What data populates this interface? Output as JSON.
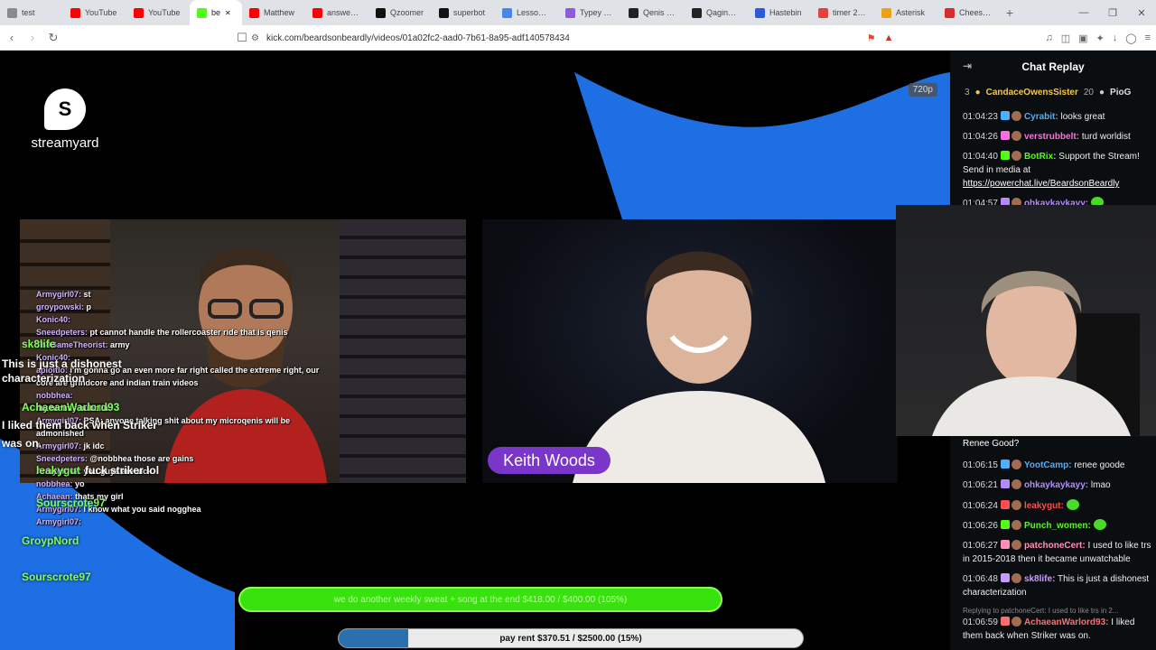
{
  "browser": {
    "tabs": [
      {
        "title": "test",
        "icon": "globe-icon",
        "color": "#8a8a8a"
      },
      {
        "title": "YouTube",
        "icon": "youtube-icon",
        "color": "#ff0000"
      },
      {
        "title": "YouTube",
        "icon": "youtube-icon",
        "color": "#ff0000"
      },
      {
        "title": "be",
        "icon": "kick-icon",
        "color": "#53fc18",
        "active": true
      },
      {
        "title": "Matthew",
        "icon": "youtube-icon",
        "color": "#ff0000"
      },
      {
        "title": "answering",
        "icon": "youtube-icon",
        "color": "#ff0000"
      },
      {
        "title": "Qzoomer",
        "icon": "x-icon",
        "color": "#111111"
      },
      {
        "title": "superbot",
        "icon": "x-icon",
        "color": "#111111"
      },
      {
        "title": "Lesson 6:",
        "icon": "doc-icon",
        "color": "#4a86e8"
      },
      {
        "title": "Typey Typ",
        "icon": "typey-icon",
        "color": "#8e5cd9"
      },
      {
        "title": "Qenis $2.4",
        "icon": "trade-icon",
        "color": "#222222"
      },
      {
        "title": "Qagina $1",
        "icon": "trade-icon",
        "color": "#222222"
      },
      {
        "title": "Hastebin",
        "icon": "hastebin-icon",
        "color": "#2b5bd7"
      },
      {
        "title": "timer 2 ho",
        "icon": "timer-icon",
        "color": "#e0443a"
      },
      {
        "title": "Asterisk",
        "icon": "asterisk-icon",
        "color": "#e8a317"
      },
      {
        "title": "Cheese C",
        "icon": "cheese-icon",
        "color": "#d92b2b"
      }
    ],
    "url": "kick.com/beardsonbeardly/videos/01a02fc2-aad0-7b61-8a95-adf140578434"
  },
  "video": {
    "brand": "streamyard",
    "quality": "720p",
    "guest_name": "Keith Woods",
    "overlay_chat": [
      {
        "user": "Armygirl07:",
        "text": "st"
      },
      {
        "user": "groypowski:",
        "text": "p"
      },
      {
        "user": "Konic40:",
        "text": ""
      },
      {
        "user": "Sneedpeters:",
        "text": "pt cannot handle the rollercoaster ride that is qenis"
      },
      {
        "user": "TheGameTheorist:",
        "text": "army"
      },
      {
        "user": "Konic40:",
        "text": ""
      },
      {
        "user": "aploitlo:",
        "text": "i'm gonna go an even more far right called the extreme right, our"
      },
      {
        "user": "",
        "text": "core are grindcore and indian train videos"
      },
      {
        "user": "nobbhea:",
        "text": ""
      },
      {
        "user": "",
        "text": "my tummy bubblin"
      },
      {
        "user": "Armygirl07:",
        "text": "PSA: anyone talking shit about my microqenis will be"
      },
      {
        "user": "",
        "text": "admonished"
      },
      {
        "user": "Armygirl07:",
        "text": "jk idc"
      },
      {
        "user": "Sneedpeters:",
        "text": "@nobbhea those are gains"
      },
      {
        "user": "Armygirl07:",
        "text": "you guys are sick"
      },
      {
        "user": "nobbhea:",
        "text": "yo"
      },
      {
        "user": "Achaean:",
        "text": "thats my girl"
      },
      {
        "user": "Armygirl07:",
        "text": "I know what you said nogghea"
      },
      {
        "user": "Armygirl07:",
        "text": ""
      }
    ],
    "overlay_big": [
      {
        "text": "sk8life"
      },
      {
        "text": "This is just a dishonest"
      },
      {
        "text": "characterization"
      },
      {
        "text": "AchaeanWarlord93"
      },
      {
        "text": "I liked them back when Striker"
      },
      {
        "text": "was on."
      },
      {
        "text": "leakygut"
      },
      {
        "text": "fuck striker lol"
      },
      {
        "text": "Sourscrote97"
      },
      {
        "text": "GroypNord"
      },
      {
        "text": "Sourscrote97"
      }
    ],
    "goal_top": {
      "text": "we do another weekly sweat + song at the end $418.00 / $400.00 (105%)"
    },
    "goal_bottom": {
      "text": "pay rent $370.51 / $2500.00 (15%)",
      "fraction": 0.15
    }
  },
  "chat": {
    "title": "Chat Replay",
    "gift": {
      "count": "3",
      "user": "CandaceOwensSister",
      "amount": "20",
      "next": "PioG"
    },
    "messages": [
      {
        "time": "01:04:23",
        "user": "Cyrabit:",
        "text": "looks great",
        "color": "#4ab0ff"
      },
      {
        "time": "01:04:26",
        "user": "verstrubbelt:",
        "text": "turd worldist",
        "color": "#ff6ee0"
      },
      {
        "time": "01:04:40",
        "user": "BotRix:",
        "text": "Support the Stream! Send in media at",
        "link": "https://powerchat.live/BeardsonBeardly",
        "color": "#53fc18"
      },
      {
        "time": "01:04:57",
        "user": "ohkaykaykayy:",
        "text": "",
        "color": "#b48bff"
      },
      {
        "time": "",
        "user": "",
        "text": "Renee Good?",
        "color": "#ffffff"
      },
      {
        "time": "01:06:15",
        "user": "YootCamp:",
        "text": "renee goode",
        "color": "#4ab0ff"
      },
      {
        "time": "01:06:21",
        "user": "ohkaykaykayy:",
        "text": "lmao",
        "color": "#b48bff"
      },
      {
        "time": "01:06:24",
        "user": "leakygut:",
        "text": "",
        "color": "#ff4d4d"
      },
      {
        "time": "01:06:26",
        "user": "Punch_women:",
        "text": "",
        "color": "#53fc18"
      },
      {
        "time": "01:06:27",
        "user": "patchoneCert:",
        "text": "I used to like trs in 2015-2018 then it became unwatchable",
        "color": "#ff8fb3"
      },
      {
        "time": "01:06:48",
        "user": "sk8life:",
        "text": "This is just a dishonest characterization",
        "color": "#c79bff"
      },
      {
        "time": "01:06:59",
        "user": "AchaeanWarlord93:",
        "text": "I liked them back when Striker was on.",
        "color": "#ff6e6e"
      }
    ],
    "reply_hint": "Replying to patchoneCert: I used to like trs in 2..."
  }
}
